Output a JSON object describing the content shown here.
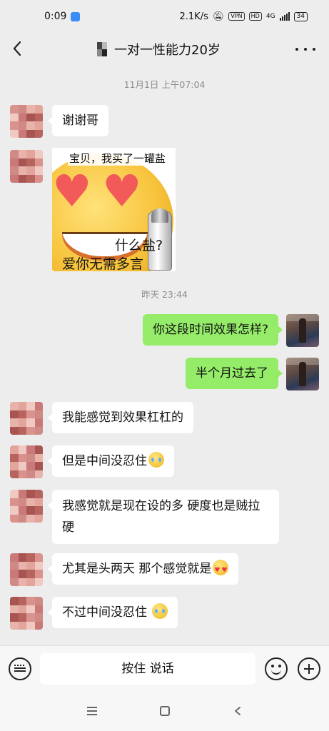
{
  "status_bar": {
    "time": "0:09",
    "speed": "2.1K/s",
    "vpn": "VPN",
    "hd": "HD",
    "network": "4G",
    "battery": "34"
  },
  "header": {
    "title": "一对一性能力20岁",
    "back_icon": "chevron-left-icon",
    "more_icon": "more-dots-icon"
  },
  "timestamps": [
    "11月1日 上午07:04",
    "昨天 23:44"
  ],
  "messages": [
    {
      "side": "left",
      "text": "谢谢哥"
    },
    {
      "side": "left",
      "type": "sticker",
      "caption_top": "宝贝，我买了一罐盐",
      "caption_mid": "什么盐?",
      "caption_bottom": "爱你无需多言"
    },
    {
      "side": "right",
      "text": "你这段时间效果怎样?"
    },
    {
      "side": "right",
      "text": "半个月过去了"
    },
    {
      "side": "left",
      "text": "我能感觉到效果杠杠的"
    },
    {
      "side": "left",
      "text": "但是中间没忍住",
      "emoji": "crying-face"
    },
    {
      "side": "left",
      "text": "我感觉就是现在设的多 硬度也是贼拉硬"
    },
    {
      "side": "left",
      "text": "尤其是头两天 那个感觉就是",
      "emoji": "heart-eyes-face"
    },
    {
      "side": "left",
      "text": "不过中间没忍住",
      "emoji": "crying-face"
    }
  ],
  "input_bar": {
    "hold_to_talk": "按住 说话",
    "keyboard_icon": "keyboard-icon",
    "emoji_icon": "smile-icon",
    "plus_icon": "plus-icon"
  },
  "colors": {
    "background": "#ededed",
    "my_bubble": "#95ec69",
    "their_bubble": "#ffffff"
  }
}
